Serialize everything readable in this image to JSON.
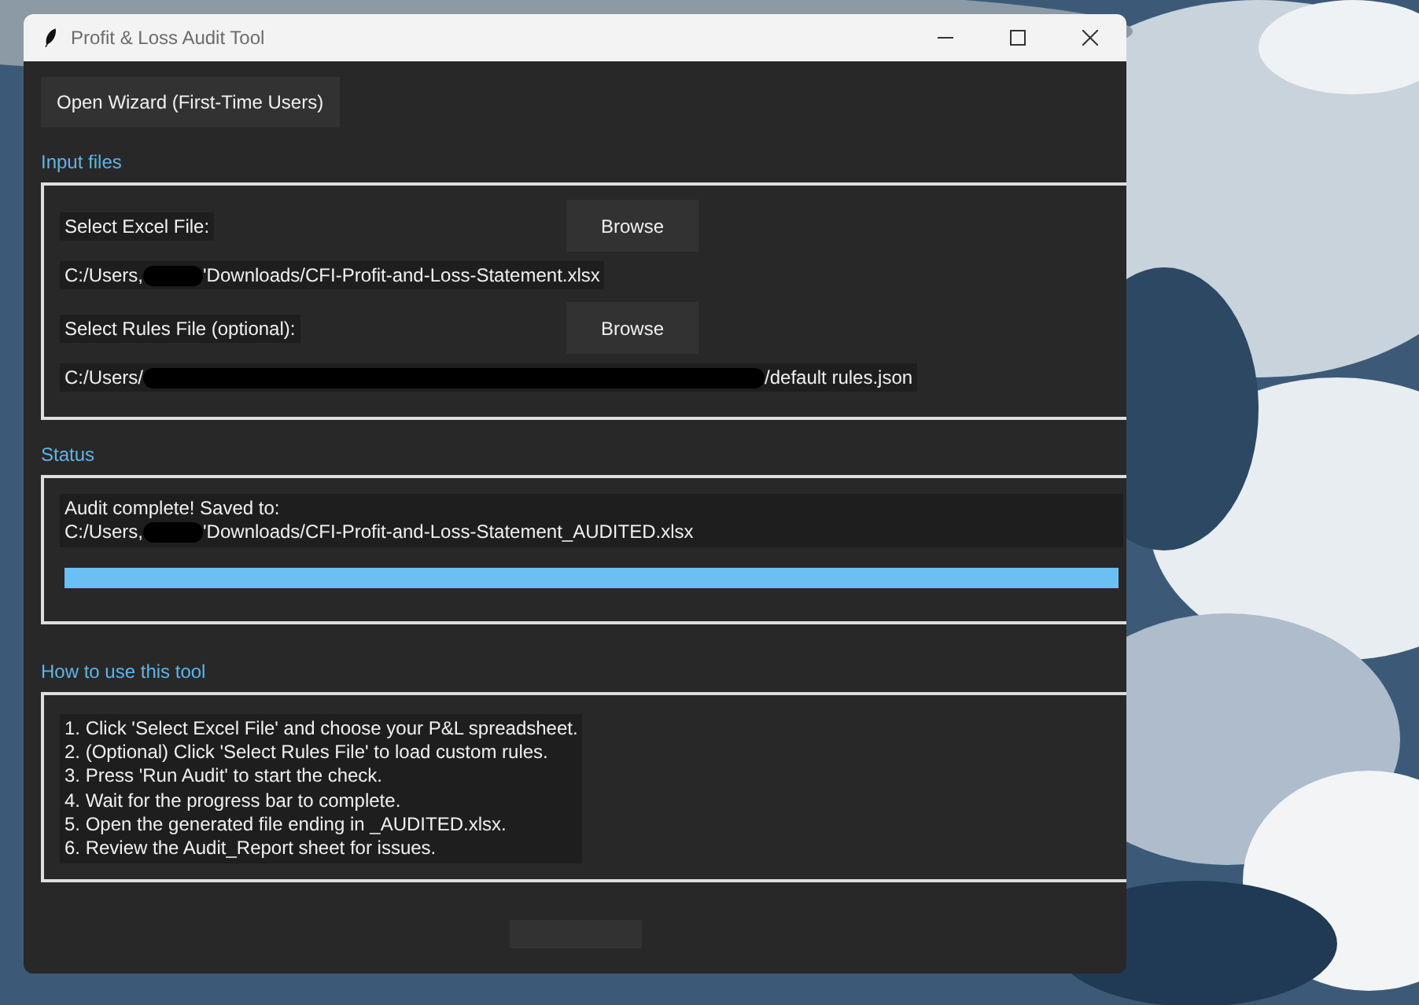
{
  "window": {
    "title": "Profit & Loss Audit Tool"
  },
  "wizard_button": "Open Wizard (First-Time Users)",
  "input_files": {
    "heading": "Input files",
    "rows": [
      {
        "label": "Select Excel File:",
        "button": "Browse",
        "path": {
          "before": "C:/Users,",
          "after": "'Downloads/CFI-Profit-and-Loss-Statement.xlsx",
          "redacted": true
        }
      },
      {
        "label": "Select Rules File (optional):",
        "button": "Browse",
        "path": {
          "before": "C:/Users/",
          "after": "/default rules.json",
          "redacted": true
        }
      }
    ]
  },
  "status": {
    "heading": "Status",
    "message_line_1": "Audit complete! Saved to:",
    "path": {
      "before": "C:/Users,",
      "after": "'Downloads/CFI-Profit-and-Loss-Statement_AUDITED.xlsx",
      "redacted": true
    },
    "progress": {
      "level": 1
    }
  },
  "help": {
    "heading": "How to use this tool",
    "lines": [
      "1. Click 'Select Excel File' and choose your P&L spreadsheet.",
      "2. (Optional) Click 'Select Rules File' to load custom rules.",
      "3. Press 'Run Audit' to start the check.",
      "4. Wait for the progress bar to complete.",
      "5. Open the generated file ending in _AUDITED.xlsx.",
      "6. Review the Audit_Report sheet for issues."
    ]
  }
}
